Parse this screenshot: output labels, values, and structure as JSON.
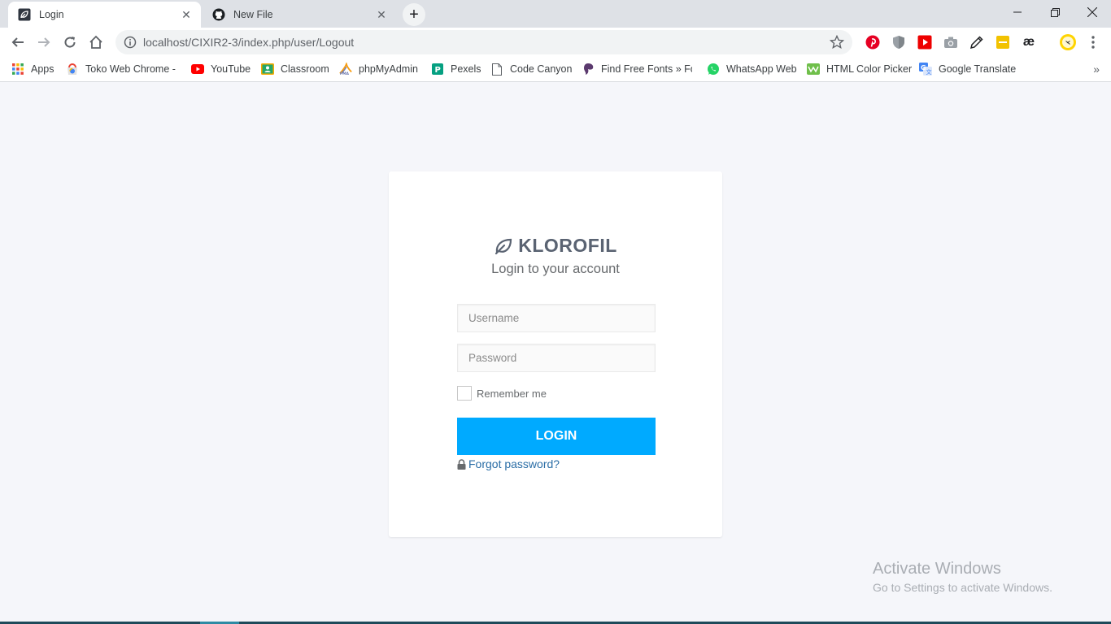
{
  "browser": {
    "tabs": [
      {
        "title": "Login",
        "active": true,
        "icon": "klorofil-leaf-icon"
      },
      {
        "title": "New File",
        "active": false,
        "icon": "github-icon"
      }
    ],
    "url": "localhost/CIXIR2-3/index.php/user/Logout",
    "bookmarks": [
      {
        "label": "Apps",
        "icon": "apps-grid-icon"
      },
      {
        "label": "Toko Web Chrome - c",
        "icon": "chrome-store-icon"
      },
      {
        "label": "YouTube",
        "icon": "youtube-icon"
      },
      {
        "label": "Classroom",
        "icon": "classroom-icon"
      },
      {
        "label": "phpMyAdmin",
        "icon": "phpmyadmin-icon"
      },
      {
        "label": "Pexels",
        "icon": "pexels-icon"
      },
      {
        "label": "Code Canyon",
        "icon": "page-icon"
      },
      {
        "label": "Find Free Fonts » For",
        "icon": "fonts-icon"
      },
      {
        "label": "WhatsApp Web",
        "icon": "whatsapp-icon"
      },
      {
        "label": "HTML Color Picker",
        "icon": "color-picker-icon"
      },
      {
        "label": "Google Translate",
        "icon": "translate-icon"
      }
    ]
  },
  "login": {
    "brand": "KLOROFIL",
    "subtitle": "Login to your account",
    "username_placeholder": "Username",
    "password_placeholder": "Password",
    "remember_label": "Remember me",
    "login_button": "LOGIN",
    "forgot_link": "Forgot password?",
    "accent_color": "#00aaff"
  },
  "watermark": {
    "line1": "Activate Windows",
    "line2": "Go to Settings to activate Windows."
  }
}
